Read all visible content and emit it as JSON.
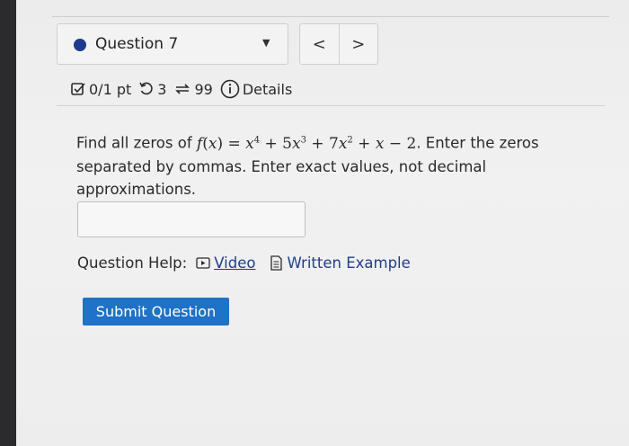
{
  "question_nav": {
    "question_label": "Question 7",
    "prev_label": "<",
    "next_label": ">"
  },
  "meta": {
    "score": "0/1 pt",
    "attempts": "3",
    "submissions": "99",
    "details_label": "Details"
  },
  "question": {
    "text_intro": "Find all zeros of",
    "text_rest_1": ". Enter the zeros",
    "text_rest_2": "separated by commas. Enter exact values, not decimal",
    "text_rest_3": "approximations."
  },
  "answer_input": {
    "value": ""
  },
  "help": {
    "label": "Question Help:",
    "video_label": "Video",
    "example_label": "Written Example"
  },
  "submit": {
    "label": "Submit Question"
  },
  "colors": {
    "accent": "#1e72c7",
    "link": "#1f3f8a",
    "dot": "#1f3a8a"
  },
  "icons": [
    "checkbox-score-icon",
    "retry-icon",
    "submissions-icon",
    "info-icon",
    "video-icon",
    "document-icon",
    "dropdown-caret-icon"
  ]
}
